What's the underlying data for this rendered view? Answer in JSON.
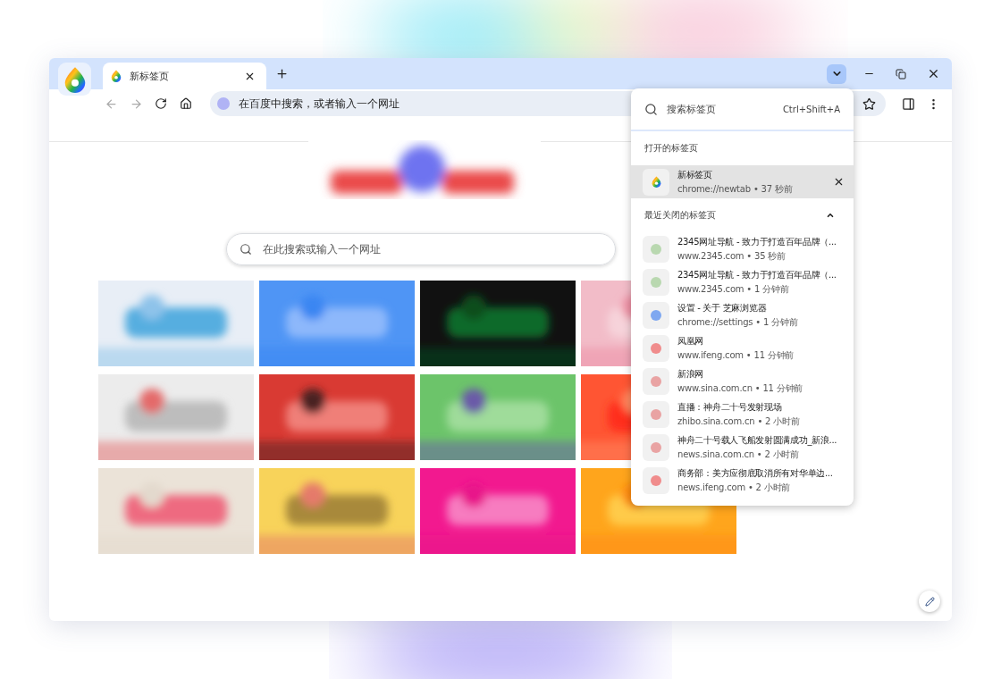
{
  "window": {
    "tab_search_open": true
  },
  "tabs": [
    {
      "title": "新标签页",
      "selected": true
    }
  ],
  "address_bar": {
    "placeholder": "在百度中搜索，或者输入一个网址"
  },
  "new_tab_page": {
    "search": {
      "placeholder": "在此搜索或输入一个网址"
    }
  },
  "tab_search": {
    "placeholder": "搜索标签页",
    "shortcut": "Ctrl+Shift+A",
    "open_section": {
      "title": "打开的标签页",
      "items": [
        {
          "title": "新标签页",
          "subtitle": "chrome://newtab • 37 秒前",
          "selected": true
        }
      ]
    },
    "recent_section": {
      "title": "最近关闭的标签页",
      "expanded": true,
      "items": [
        {
          "title": "2345网址导航 - 致力于打造百年品牌（...",
          "subtitle": "www.2345.com • 35 秒前",
          "color": "#b9d8b0"
        },
        {
          "title": "2345网址导航 - 致力于打造百年品牌（...",
          "subtitle": "www.2345.com • 1 分钟前",
          "color": "#b9d8b0"
        },
        {
          "title": "设置 - 关于 芝麻浏览器",
          "subtitle": "chrome://settings • 1 分钟前",
          "color": "#7fa8f0"
        },
        {
          "title": "凤凰网",
          "subtitle": "www.ifeng.com • 11 分钟前",
          "color": "#f08c8c"
        },
        {
          "title": "新浪网",
          "subtitle": "www.sina.com.cn • 11 分钟前",
          "color": "#e9a3a3"
        },
        {
          "title": "直播：神舟二十号发射现场",
          "subtitle": "zhibo.sina.com.cn • 2 小时前",
          "color": "#e9a3a3"
        },
        {
          "title": "神舟二十号载人飞船发射圆满成功_新浪...",
          "subtitle": "news.sina.com.cn • 2 小时前",
          "color": "#e9a3a3"
        },
        {
          "title": "商务部：美方应彻底取消所有对华单边...",
          "subtitle": "news.ifeng.com • 2 小时前",
          "color": "#f08c8c"
        }
      ]
    }
  }
}
